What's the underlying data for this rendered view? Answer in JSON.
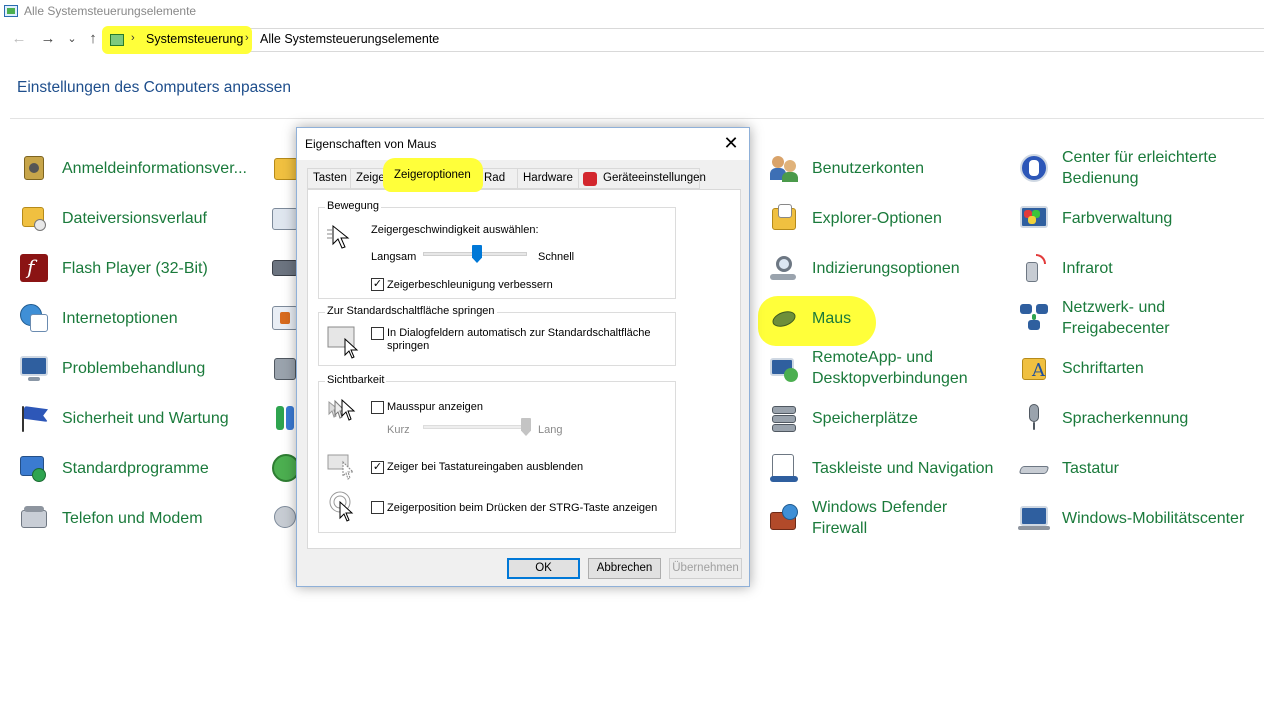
{
  "window": {
    "title": "Alle Systemsteuerungselemente"
  },
  "nav": {
    "back": "←",
    "forward": "→",
    "recent": "⌄",
    "up": "↑",
    "breadcrumb": [
      "Systemsteuerung",
      "Alle Systemsteuerungselemente"
    ],
    "sep": "›"
  },
  "heading": "Einstellungen des Computers anpassen",
  "items": {
    "col1": [
      "Anmeldeinformationsver...",
      "Dateiversionsverlauf",
      "Flash Player (32-Bit)",
      "Internetoptionen",
      "Problembehandlung",
      "Sicherheit und Wartung",
      "Standardprogramme",
      "Telefon und Modem"
    ],
    "col3": [
      "Benutzerkonten",
      "Explorer-Optionen",
      "Indizierungsoptionen",
      "Maus",
      "RemoteApp- und Desktopverbindungen",
      "Speicherplätze",
      "Taskleiste und Navigation",
      "Windows Defender Firewall"
    ],
    "col4": [
      "Center für erleichterte Bedienung",
      "Farbverwaltung",
      "Infrarot",
      "Netzwerk- und Freigabecenter",
      "Schriftarten",
      "Spracherkennung",
      "Tastatur",
      "Windows-Mobilitätscenter"
    ]
  },
  "dialog": {
    "title": "Eigenschaften von Maus",
    "close": "✕",
    "tabs": [
      "Tasten",
      "Zeiger",
      "Zeigeroptionen",
      "Rad",
      "Hardware",
      "Geräteeinstellungen"
    ],
    "active_tab": "Zeigeroptionen",
    "motion": {
      "title": "Bewegung",
      "speed_label": "Zeigergeschwindigkeit auswählen:",
      "slow": "Langsam",
      "fast": "Schnell",
      "speed_value_fraction": 0.5,
      "precision_label": "Zeigerbeschleunigung verbessern",
      "precision_checked": true
    },
    "snap": {
      "title": "Zur Standardschaltfläche springen",
      "label_line1": "In Dialogfeldern automatisch zur Standardschaltfläche",
      "label_line2": "springen",
      "checked": false
    },
    "visibility": {
      "title": "Sichtbarkeit",
      "trails_label": "Mausspur anzeigen",
      "trails_checked": false,
      "short": "Kurz",
      "long": "Lang",
      "trails_value_fraction": 1.0,
      "hide_label": "Zeiger bei Tastatureingaben ausblenden",
      "hide_checked": true,
      "ctrl_label": "Zeigerposition beim Drücken der STRG-Taste anzeigen",
      "ctrl_checked": false
    },
    "buttons": {
      "ok": "OK",
      "cancel": "Abbrechen",
      "apply": "Übernehmen"
    }
  },
  "colors": {
    "link_green": "#1a7a3b",
    "heading_blue": "#1e4e8c",
    "highlight": "#ffff3a",
    "accent": "#0078d7"
  }
}
